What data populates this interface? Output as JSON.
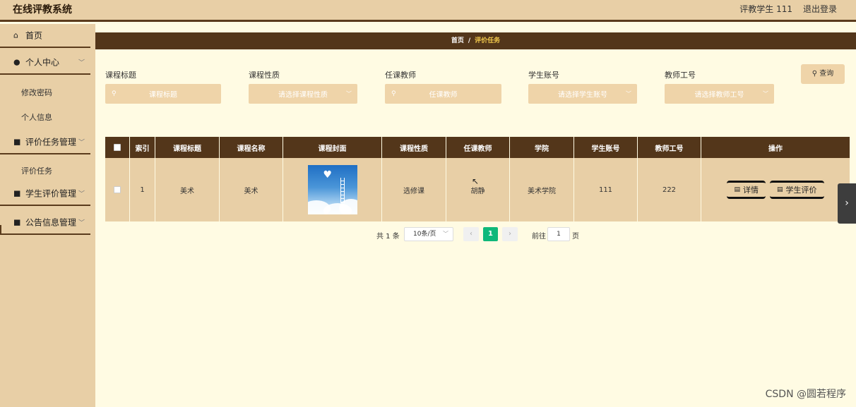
{
  "header": {
    "title": "在线评教系统",
    "user": "评教学生 111",
    "logout": "退出登录"
  },
  "sidebar": {
    "items": [
      {
        "label": "首页",
        "icon": "home-icon"
      },
      {
        "label": "个人中心",
        "icon": "user-icon",
        "children": [
          "修改密码",
          "个人信息"
        ]
      },
      {
        "label": "评价任务管理",
        "icon": "grid-icon",
        "children": [
          "评价任务"
        ]
      },
      {
        "label": "学生评价管理",
        "icon": "grid-icon"
      },
      {
        "label": "公告信息管理",
        "icon": "grid-icon"
      }
    ]
  },
  "breadcrumb": {
    "home": "首页",
    "sep": "/",
    "current": "评价任务"
  },
  "search": {
    "fields": [
      {
        "label": "课程标题",
        "placeholder": "课程标题"
      },
      {
        "label": "课程性质",
        "placeholder": "请选择课程性质"
      },
      {
        "label": "任课教师",
        "placeholder": "任课教师"
      },
      {
        "label": "学生账号",
        "placeholder": "请选择学生账号"
      },
      {
        "label": "教师工号",
        "placeholder": "请选择教师工号"
      }
    ],
    "query_button": "查询"
  },
  "table": {
    "columns": [
      "索引",
      "课程标题",
      "课程名称",
      "课程封面",
      "课程性质",
      "任课教师",
      "学院",
      "学生账号",
      "教师工号",
      "操作"
    ],
    "rows": [
      {
        "index": "1",
        "title": "美术",
        "name": "美术",
        "nature": "选修课",
        "teacher": "胡静",
        "college": "美术学院",
        "student": "111",
        "teacher_id": "222"
      }
    ],
    "actions": [
      "详情",
      "学生评价"
    ]
  },
  "pagination": {
    "total": "共 1 条",
    "page_size": "10条/页",
    "current": "1",
    "goto_label": "前往",
    "goto_value": "1",
    "page_suffix": "页"
  },
  "watermark": "CSDN @圆若程序"
}
